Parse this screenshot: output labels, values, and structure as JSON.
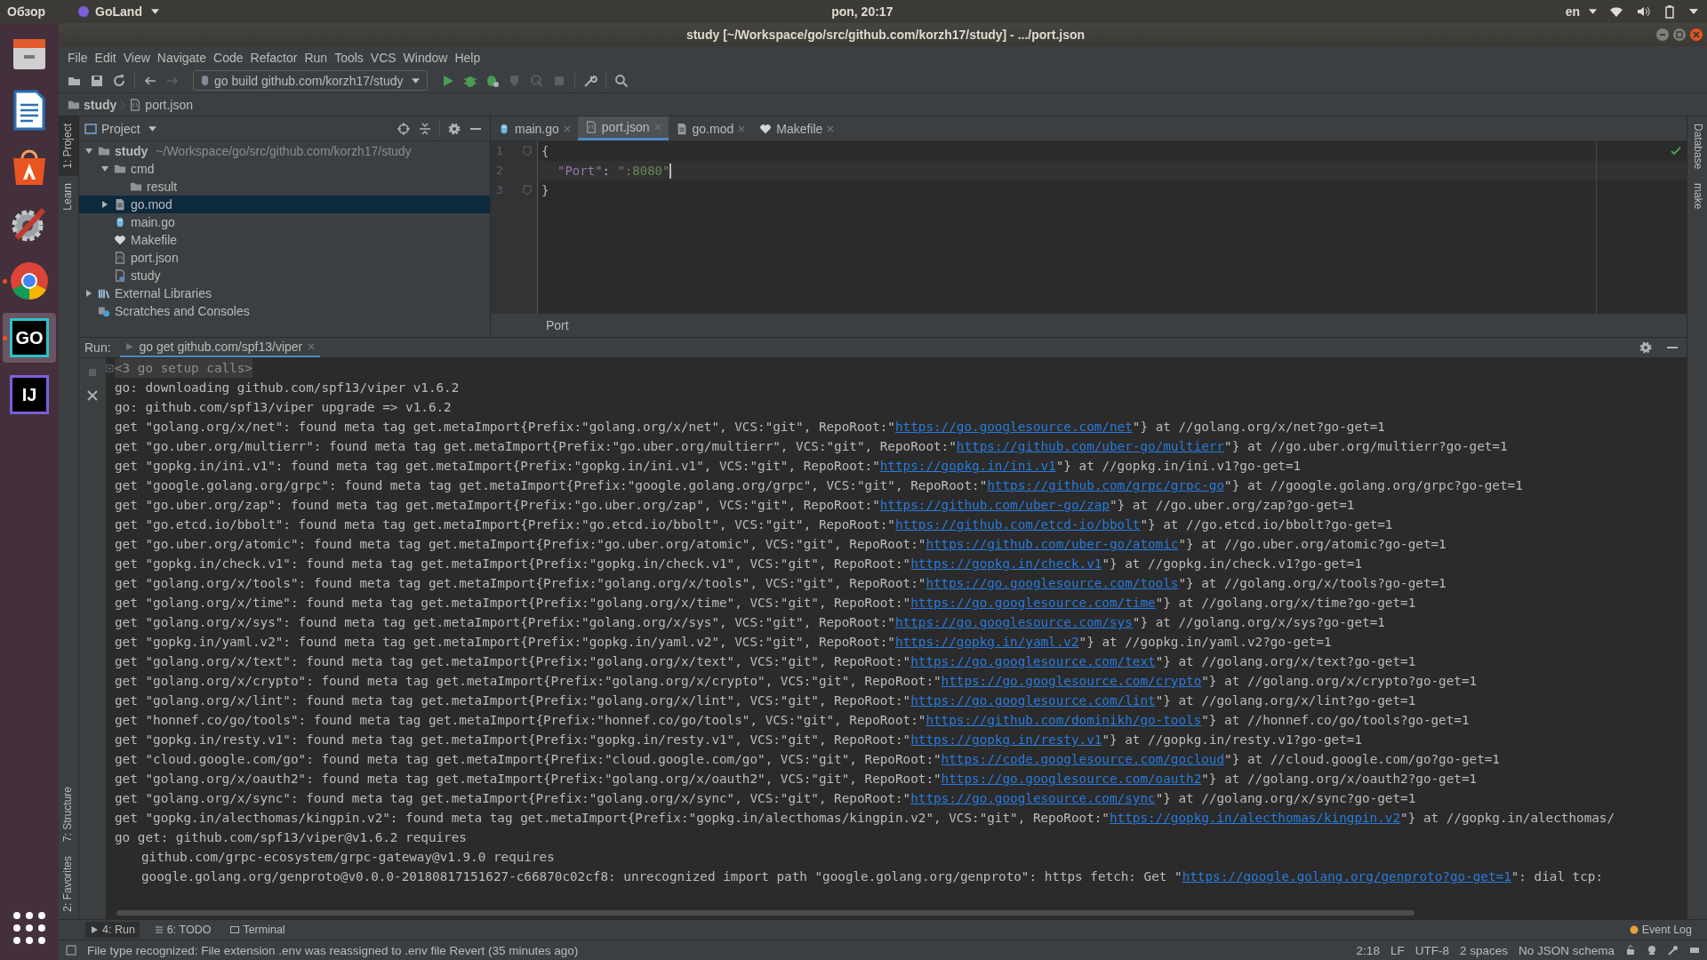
{
  "top_bar": {
    "activities": "Обзор",
    "app_menu": "GoLand",
    "clock": "pon, 20:17",
    "language": "en"
  },
  "dock": [
    {
      "kind": "files",
      "running": false,
      "selected": false
    },
    {
      "kind": "writer",
      "running": false,
      "selected": false
    },
    {
      "kind": "store",
      "running": false,
      "selected": false
    },
    {
      "kind": "settings",
      "running": false,
      "selected": false
    },
    {
      "kind": "browser",
      "running": true,
      "selected": false
    },
    {
      "kind": "goland",
      "label": "GO",
      "running": true,
      "selected": true
    },
    {
      "kind": "intellij",
      "label": "IJ",
      "running": false,
      "selected": false
    },
    {
      "kind": "apps",
      "running": false,
      "selected": false
    }
  ],
  "window": {
    "title": "study [~/Workspace/go/src/github.com/korzh17/study] - .../port.json"
  },
  "menu": [
    "File",
    "Edit",
    "View",
    "Navigate",
    "Code",
    "Refactor",
    "Run",
    "Tools",
    "VCS",
    "Window",
    "Help"
  ],
  "toolbar": {
    "run_config": "go build github.com/korzh17/study"
  },
  "breadcrumb": [
    {
      "label": "study",
      "kind": "folder"
    },
    {
      "label": "port.json",
      "kind": "json"
    }
  ],
  "left_stripe": {
    "top": [
      {
        "label": "1: Project",
        "selected": true
      },
      {
        "label": "Learn",
        "selected": false
      }
    ],
    "bottom": [
      {
        "label": "7: Structure",
        "selected": false
      },
      {
        "label": "2: Favorites",
        "selected": false
      }
    ]
  },
  "project_panel": {
    "title": "Project",
    "tree": [
      {
        "name": "study",
        "hint": "~/Workspace/go/src/github.com/korzh17/study",
        "kind": "folder",
        "expanded": true,
        "selected": false,
        "children": [
          {
            "name": "cmd",
            "kind": "folder",
            "expanded": true,
            "selected": false,
            "children": [
              {
                "name": "result",
                "kind": "folder",
                "selected": false
              }
            ]
          },
          {
            "name": "go.mod",
            "kind": "gomod",
            "expanded": false,
            "selected": true
          },
          {
            "name": "main.go",
            "kind": "go",
            "selected": false
          },
          {
            "name": "Makefile",
            "kind": "makefile",
            "selected": false
          },
          {
            "name": "port.json",
            "kind": "json",
            "selected": false
          },
          {
            "name": "study",
            "kind": "binary",
            "selected": false
          }
        ]
      },
      {
        "name": "External Libraries",
        "kind": "libraries",
        "expanded": false,
        "selected": false
      },
      {
        "name": "Scratches and Consoles",
        "kind": "scratches",
        "selected": false
      }
    ]
  },
  "editor": {
    "tabs": [
      {
        "label": "main.go",
        "kind": "go",
        "selected": false
      },
      {
        "label": "port.json",
        "kind": "json",
        "selected": true
      },
      {
        "label": "go.mod",
        "kind": "gomod",
        "selected": false
      },
      {
        "label": "Makefile",
        "kind": "makefile",
        "selected": false
      }
    ],
    "lines": [
      {
        "number": "1",
        "current": false,
        "indented": false,
        "tokens": [
          {
            "text": "{",
            "kind": "punct"
          }
        ]
      },
      {
        "number": "2",
        "current": true,
        "indented": true,
        "tokens": [
          {
            "text": "\"Port\"",
            "kind": "key"
          },
          {
            "text": ": ",
            "kind": "punct"
          },
          {
            "text": "\":8080\"",
            "kind": "string"
          }
        ]
      },
      {
        "number": "3",
        "current": false,
        "indented": false,
        "tokens": [
          {
            "text": "}",
            "kind": "punct"
          }
        ]
      }
    ],
    "path": "Port"
  },
  "right_stripe": [
    "Database",
    "make"
  ],
  "run_panel": {
    "label": "Run:",
    "tab": "go get github.com/spf13/viper",
    "lines": [
      {
        "folded": true,
        "indented": false,
        "parts": [
          {
            "text": "<3 go setup calls>",
            "link": false
          }
        ]
      },
      {
        "folded": false,
        "indented": false,
        "parts": [
          {
            "text": "go: downloading github.com/spf13/viper v1.6.2",
            "link": false
          }
        ]
      },
      {
        "folded": false,
        "indented": false,
        "parts": [
          {
            "text": "go: github.com/spf13/viper upgrade => v1.6.2",
            "link": false
          }
        ]
      },
      {
        "folded": false,
        "indented": false,
        "parts": [
          {
            "text": "get \"golang.org/x/net\": found meta tag get.metaImport{Prefix:\"golang.org/x/net\", VCS:\"git\", RepoRoot:\"",
            "link": false
          },
          {
            "text": "https://go.googlesource.com/net",
            "link": true
          },
          {
            "text": "\"} at //golang.org/x/net?go-get=1",
            "link": false
          }
        ]
      },
      {
        "folded": false,
        "indented": false,
        "parts": [
          {
            "text": "get \"go.uber.org/multierr\": found meta tag get.metaImport{Prefix:\"go.uber.org/multierr\", VCS:\"git\", RepoRoot:\"",
            "link": false
          },
          {
            "text": "https://github.com/uber-go/multierr",
            "link": true
          },
          {
            "text": "\"} at //go.uber.org/multierr?go-get=1",
            "link": false
          }
        ]
      },
      {
        "folded": false,
        "indented": false,
        "parts": [
          {
            "text": "get \"gopkg.in/ini.v1\": found meta tag get.metaImport{Prefix:\"gopkg.in/ini.v1\", VCS:\"git\", RepoRoot:\"",
            "link": false
          },
          {
            "text": "https://gopkg.in/ini.v1",
            "link": true
          },
          {
            "text": "\"} at //gopkg.in/ini.v1?go-get=1",
            "link": false
          }
        ]
      },
      {
        "folded": false,
        "indented": false,
        "parts": [
          {
            "text": "get \"google.golang.org/grpc\": found meta tag get.metaImport{Prefix:\"google.golang.org/grpc\", VCS:\"git\", RepoRoot:\"",
            "link": false
          },
          {
            "text": "https://github.com/grpc/grpc-go",
            "link": true
          },
          {
            "text": "\"} at //google.golang.org/grpc?go-get=1",
            "link": false
          }
        ]
      },
      {
        "folded": false,
        "indented": false,
        "parts": [
          {
            "text": "get \"go.uber.org/zap\": found meta tag get.metaImport{Prefix:\"go.uber.org/zap\", VCS:\"git\", RepoRoot:\"",
            "link": false
          },
          {
            "text": "https://github.com/uber-go/zap",
            "link": true
          },
          {
            "text": "\"} at //go.uber.org/zap?go-get=1",
            "link": false
          }
        ]
      },
      {
        "folded": false,
        "indented": false,
        "parts": [
          {
            "text": "get \"go.etcd.io/bbolt\": found meta tag get.metaImport{Prefix:\"go.etcd.io/bbolt\", VCS:\"git\", RepoRoot:\"",
            "link": false
          },
          {
            "text": "https://github.com/etcd-io/bbolt",
            "link": true
          },
          {
            "text": "\"} at //go.etcd.io/bbolt?go-get=1",
            "link": false
          }
        ]
      },
      {
        "folded": false,
        "indented": false,
        "parts": [
          {
            "text": "get \"go.uber.org/atomic\": found meta tag get.metaImport{Prefix:\"go.uber.org/atomic\", VCS:\"git\", RepoRoot:\"",
            "link": false
          },
          {
            "text": "https://github.com/uber-go/atomic",
            "link": true
          },
          {
            "text": "\"} at //go.uber.org/atomic?go-get=1",
            "link": false
          }
        ]
      },
      {
        "folded": false,
        "indented": false,
        "parts": [
          {
            "text": "get \"gopkg.in/check.v1\": found meta tag get.metaImport{Prefix:\"gopkg.in/check.v1\", VCS:\"git\", RepoRoot:\"",
            "link": false
          },
          {
            "text": "https://gopkg.in/check.v1",
            "link": true
          },
          {
            "text": "\"} at //gopkg.in/check.v1?go-get=1",
            "link": false
          }
        ]
      },
      {
        "folded": false,
        "indented": false,
        "parts": [
          {
            "text": "get \"golang.org/x/tools\": found meta tag get.metaImport{Prefix:\"golang.org/x/tools\", VCS:\"git\", RepoRoot:\"",
            "link": false
          },
          {
            "text": "https://go.googlesource.com/tools",
            "link": true
          },
          {
            "text": "\"} at //golang.org/x/tools?go-get=1",
            "link": false
          }
        ]
      },
      {
        "folded": false,
        "indented": false,
        "parts": [
          {
            "text": "get \"golang.org/x/time\": found meta tag get.metaImport{Prefix:\"golang.org/x/time\", VCS:\"git\", RepoRoot:\"",
            "link": false
          },
          {
            "text": "https://go.googlesource.com/time",
            "link": true
          },
          {
            "text": "\"} at //golang.org/x/time?go-get=1",
            "link": false
          }
        ]
      },
      {
        "folded": false,
        "indented": false,
        "parts": [
          {
            "text": "get \"golang.org/x/sys\": found meta tag get.metaImport{Prefix:\"golang.org/x/sys\", VCS:\"git\", RepoRoot:\"",
            "link": false
          },
          {
            "text": "https://go.googlesource.com/sys",
            "link": true
          },
          {
            "text": "\"} at //golang.org/x/sys?go-get=1",
            "link": false
          }
        ]
      },
      {
        "folded": false,
        "indented": false,
        "parts": [
          {
            "text": "get \"gopkg.in/yaml.v2\": found meta tag get.metaImport{Prefix:\"gopkg.in/yaml.v2\", VCS:\"git\", RepoRoot:\"",
            "link": false
          },
          {
            "text": "https://gopkg.in/yaml.v2",
            "link": true
          },
          {
            "text": "\"} at //gopkg.in/yaml.v2?go-get=1",
            "link": false
          }
        ]
      },
      {
        "folded": false,
        "indented": false,
        "parts": [
          {
            "text": "get \"golang.org/x/text\": found meta tag get.metaImport{Prefix:\"golang.org/x/text\", VCS:\"git\", RepoRoot:\"",
            "link": false
          },
          {
            "text": "https://go.googlesource.com/text",
            "link": true
          },
          {
            "text": "\"} at //golang.org/x/text?go-get=1",
            "link": false
          }
        ]
      },
      {
        "folded": false,
        "indented": false,
        "parts": [
          {
            "text": "get \"golang.org/x/crypto\": found meta tag get.metaImport{Prefix:\"golang.org/x/crypto\", VCS:\"git\", RepoRoot:\"",
            "link": false
          },
          {
            "text": "https://go.googlesource.com/crypto",
            "link": true
          },
          {
            "text": "\"} at //golang.org/x/crypto?go-get=1",
            "link": false
          }
        ]
      },
      {
        "folded": false,
        "indented": false,
        "parts": [
          {
            "text": "get \"golang.org/x/lint\": found meta tag get.metaImport{Prefix:\"golang.org/x/lint\", VCS:\"git\", RepoRoot:\"",
            "link": false
          },
          {
            "text": "https://go.googlesource.com/lint",
            "link": true
          },
          {
            "text": "\"} at //golang.org/x/lint?go-get=1",
            "link": false
          }
        ]
      },
      {
        "folded": false,
        "indented": false,
        "parts": [
          {
            "text": "get \"honnef.co/go/tools\": found meta tag get.metaImport{Prefix:\"honnef.co/go/tools\", VCS:\"git\", RepoRoot:\"",
            "link": false
          },
          {
            "text": "https://github.com/dominikh/go-tools",
            "link": true
          },
          {
            "text": "\"} at //honnef.co/go/tools?go-get=1",
            "link": false
          }
        ]
      },
      {
        "folded": false,
        "indented": false,
        "parts": [
          {
            "text": "get \"gopkg.in/resty.v1\": found meta tag get.metaImport{Prefix:\"gopkg.in/resty.v1\", VCS:\"git\", RepoRoot:\"",
            "link": false
          },
          {
            "text": "https://gopkg.in/resty.v1",
            "link": true
          },
          {
            "text": "\"} at //gopkg.in/resty.v1?go-get=1",
            "link": false
          }
        ]
      },
      {
        "folded": false,
        "indented": false,
        "parts": [
          {
            "text": "get \"cloud.google.com/go\": found meta tag get.metaImport{Prefix:\"cloud.google.com/go\", VCS:\"git\", RepoRoot:\"",
            "link": false
          },
          {
            "text": "https://code.googlesource.com/gocloud",
            "link": true
          },
          {
            "text": "\"} at //cloud.google.com/go?go-get=1",
            "link": false
          }
        ]
      },
      {
        "folded": false,
        "indented": false,
        "parts": [
          {
            "text": "get \"golang.org/x/oauth2\": found meta tag get.metaImport{Prefix:\"golang.org/x/oauth2\", VCS:\"git\", RepoRoot:\"",
            "link": false
          },
          {
            "text": "https://go.googlesource.com/oauth2",
            "link": true
          },
          {
            "text": "\"} at //golang.org/x/oauth2?go-get=1",
            "link": false
          }
        ]
      },
      {
        "folded": false,
        "indented": false,
        "parts": [
          {
            "text": "get \"golang.org/x/sync\": found meta tag get.metaImport{Prefix:\"golang.org/x/sync\", VCS:\"git\", RepoRoot:\"",
            "link": false
          },
          {
            "text": "https://go.googlesource.com/sync",
            "link": true
          },
          {
            "text": "\"} at //golang.org/x/sync?go-get=1",
            "link": false
          }
        ]
      },
      {
        "folded": false,
        "indented": false,
        "parts": [
          {
            "text": "get \"gopkg.in/alecthomas/kingpin.v2\": found meta tag get.metaImport{Prefix:\"gopkg.in/alecthomas/kingpin.v2\", VCS:\"git\", RepoRoot:\"",
            "link": false
          },
          {
            "text": "https://gopkg.in/alecthomas/kingpin.v2",
            "link": true
          },
          {
            "text": "\"} at //gopkg.in/alecthomas/",
            "link": false
          }
        ]
      },
      {
        "folded": false,
        "indented": false,
        "parts": [
          {
            "text": "go get: github.com/spf13/viper@v1.6.2 requires",
            "link": false
          }
        ]
      },
      {
        "folded": false,
        "indented": true,
        "parts": [
          {
            "text": "github.com/grpc-ecosystem/grpc-gateway@v1.9.0 requires",
            "link": false
          }
        ]
      },
      {
        "folded": false,
        "indented": true,
        "parts": [
          {
            "text": "google.golang.org/genproto@v0.0.0-20180817151627-c66870c02cf8: unrecognized import path \"google.golang.org/genproto\": https fetch: Get \"",
            "link": false
          },
          {
            "text": "https://google.golang.org/genproto?go-get=1",
            "link": true
          },
          {
            "text": "\": dial tcp:",
            "link": false
          }
        ]
      }
    ]
  },
  "bottom_tabs": [
    {
      "label": "4: Run",
      "kind": "run",
      "selected": true
    },
    {
      "label": "6: TODO",
      "kind": "todo",
      "selected": false
    },
    {
      "label": "Terminal",
      "kind": "terminal",
      "selected": false
    }
  ],
  "event_log": "Event Log",
  "status_bar": {
    "message": "File type recognized: File extension .env was reassigned to .env file Revert (35 minutes ago)",
    "items": [
      "2:18",
      "LF",
      "UTF-8",
      "2 spaces",
      "No JSON schema"
    ]
  }
}
